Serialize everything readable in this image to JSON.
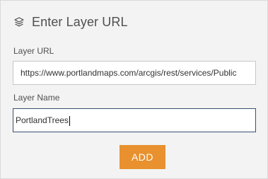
{
  "header": {
    "icon": "layers-icon",
    "title": "Enter Layer URL"
  },
  "layer_url": {
    "label": "Layer URL",
    "value": "https://www.portlandmaps.com/arcgis/rest/services/Public"
  },
  "layer_name": {
    "label": "Layer Name",
    "value": "PortlandTrees"
  },
  "add_button": {
    "label": "ADD",
    "color": "#e8912e"
  }
}
